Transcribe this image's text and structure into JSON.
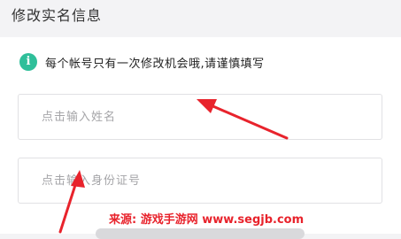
{
  "header": {
    "title": "修改实名信息"
  },
  "notice": {
    "icon": "info-icon",
    "icon_glyph": "i",
    "icon_color": "#2fbf9a",
    "text": "每个帐号只有一次修改机会哦,请谨慎填写"
  },
  "form": {
    "name_placeholder": "点击输入姓名",
    "id_placeholder": "点击输入身份证号"
  },
  "watermark": {
    "text": "来源: 游戏手游网 www.segjb.com"
  },
  "annotation_color": "#e8232c"
}
